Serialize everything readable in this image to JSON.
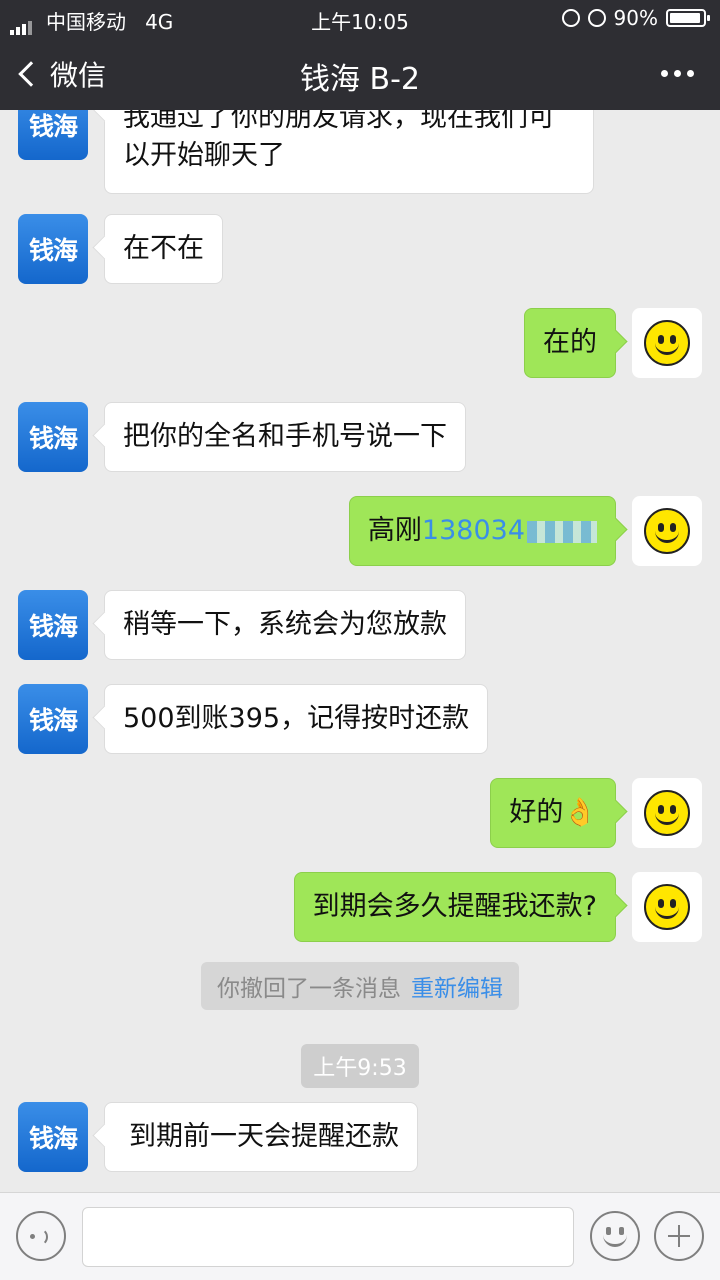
{
  "status_bar": {
    "carrier": "中国移动",
    "network": "4G",
    "time": "上午10:05",
    "battery": "90%"
  },
  "nav": {
    "back_label": "微信",
    "title": "钱海 B-2"
  },
  "contact_avatar_text": "钱海",
  "messages": [
    {
      "side": "left",
      "text": "我通过了你的朋友请求，现在我们可以开始聊天了"
    },
    {
      "side": "left",
      "text": "在不在"
    },
    {
      "side": "right",
      "text": "在的"
    },
    {
      "side": "left",
      "text": "把你的全名和手机号说一下"
    },
    {
      "side": "right",
      "name": "高刚",
      "phone": "138034"
    },
    {
      "side": "left",
      "text": "稍等一下，系统会为您放款"
    },
    {
      "side": "left",
      "text": "500到账395，记得按时还款"
    },
    {
      "side": "right",
      "text": "好的👌"
    },
    {
      "side": "right",
      "text": "到期会多久提醒我还款?"
    },
    {
      "side": "left",
      "text": "到期前一天会提醒还款"
    }
  ],
  "recall_notice": {
    "text": "你撤回了一条消息",
    "link": "重新编辑"
  },
  "timestamp": "上午9:53",
  "colors": {
    "bar_bg": "#2e2e33",
    "chat_bg": "#ebebeb",
    "my_bubble": "#9fe658",
    "link": "#3a8ee8"
  }
}
